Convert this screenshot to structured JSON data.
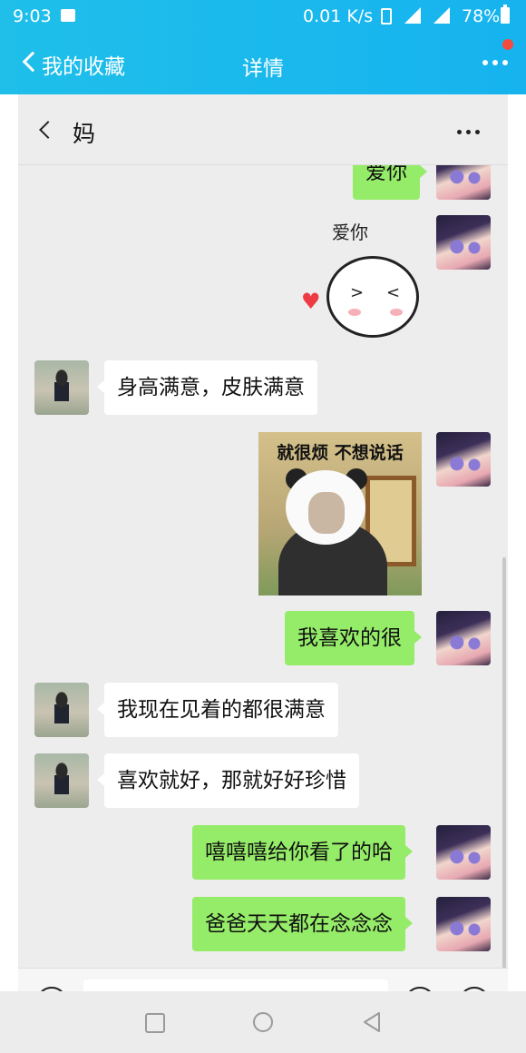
{
  "status_bar": {
    "time": "9:03",
    "network_speed": "0.01 K/s",
    "network_type": "4G",
    "battery_percent": "78%"
  },
  "header": {
    "back_label": "我的收藏",
    "title": "详情",
    "accent_color": "#16b3ef",
    "notification_color": "#f44b3f"
  },
  "chat": {
    "contact_name": "妈",
    "sticker_love_caption": "爱你",
    "sticker_panda_caption": "就很烦 不想说话",
    "messages": [
      {
        "sender": "me",
        "type": "text",
        "text": "爱你"
      },
      {
        "sender": "me",
        "type": "sticker",
        "sticker": "love-you-blob"
      },
      {
        "sender": "mom",
        "type": "text",
        "text": "身高满意，皮肤满意"
      },
      {
        "sender": "me",
        "type": "sticker",
        "sticker": "panda-meme"
      },
      {
        "sender": "me",
        "type": "text",
        "text": "我喜欢的很"
      },
      {
        "sender": "mom",
        "type": "text",
        "text": "我现在见着的都很满意"
      },
      {
        "sender": "mom",
        "type": "text",
        "text": "喜欢就好，那就好好珍惜"
      },
      {
        "sender": "me",
        "type": "text",
        "text": "嘻嘻嘻给你看了的哈"
      },
      {
        "sender": "me",
        "type": "text",
        "text": "爸爸天天都在念念念"
      }
    ],
    "colors": {
      "my_bubble": "#95ec69",
      "other_bubble": "#ffffff",
      "background": "#ededed"
    }
  },
  "nav_bar": {
    "icons": [
      "square-recents-icon",
      "circle-home-icon",
      "triangle-back-icon"
    ]
  }
}
